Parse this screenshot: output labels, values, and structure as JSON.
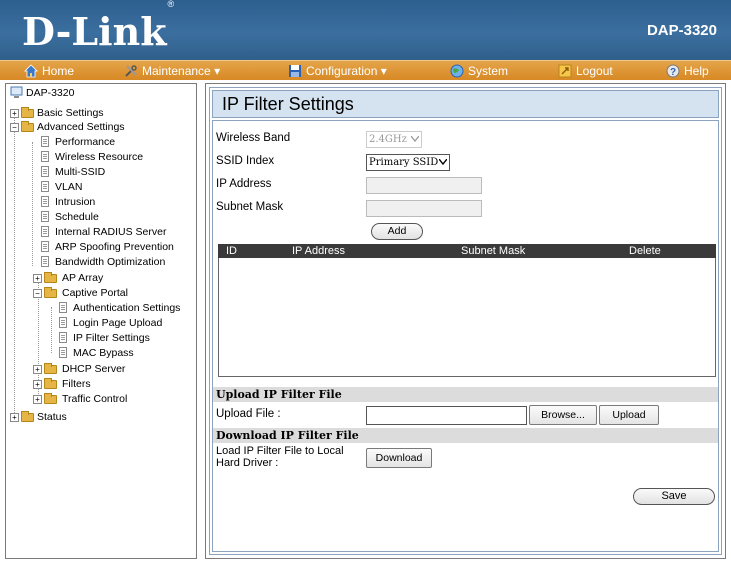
{
  "header": {
    "brand": "D-Link",
    "brand_mark": "®",
    "model": "DAP-3320"
  },
  "menu": [
    {
      "label": "Home",
      "icon": "home-icon"
    },
    {
      "label": "Maintenance",
      "icon": "tools-icon"
    },
    {
      "label": "Configuration",
      "icon": "save-disk-icon"
    },
    {
      "label": "System",
      "icon": "globe-icon"
    },
    {
      "label": "Logout",
      "icon": "logout-icon"
    },
    {
      "label": "Help",
      "icon": "help-icon"
    }
  ],
  "tree": {
    "root": "DAP-3320",
    "basic": "Basic Settings",
    "advanced": "Advanced Settings",
    "adv_items": [
      "Performance",
      "Wireless Resource",
      "Multi-SSID",
      "VLAN",
      "Intrusion",
      "Schedule",
      "Internal RADIUS Server",
      "ARP Spoofing Prevention",
      "Bandwidth Optimization"
    ],
    "ap_array": "AP Array",
    "captive": "Captive Portal",
    "captive_items": [
      "Authentication Settings",
      "Login Page Upload",
      "IP Filter Settings",
      "MAC Bypass"
    ],
    "dhcp": "DHCP Server",
    "filters": "Filters",
    "traffic": "Traffic Control",
    "status": "Status"
  },
  "page": {
    "title": "IP Filter Settings",
    "wireless_band_label": "Wireless Band",
    "wireless_band_value": "2.4GHz",
    "ssid_index_label": "SSID Index",
    "ssid_index_value": "Primary SSID",
    "ip_address_label": "IP Address",
    "subnet_mask_label": "Subnet Mask",
    "add_button": "Add",
    "table_headers": [
      "ID",
      "IP Address",
      "Subnet Mask",
      "Delete"
    ],
    "upload_section": "Upload IP Filter File",
    "upload_file_label": "Upload File :",
    "browse_button": "Browse...",
    "upload_button": "Upload",
    "download_section": "Download IP Filter File",
    "download_label_1": "Load IP Filter File to Local",
    "download_label_2": "Hard Driver :",
    "download_button": "Download",
    "save_button": "Save"
  }
}
